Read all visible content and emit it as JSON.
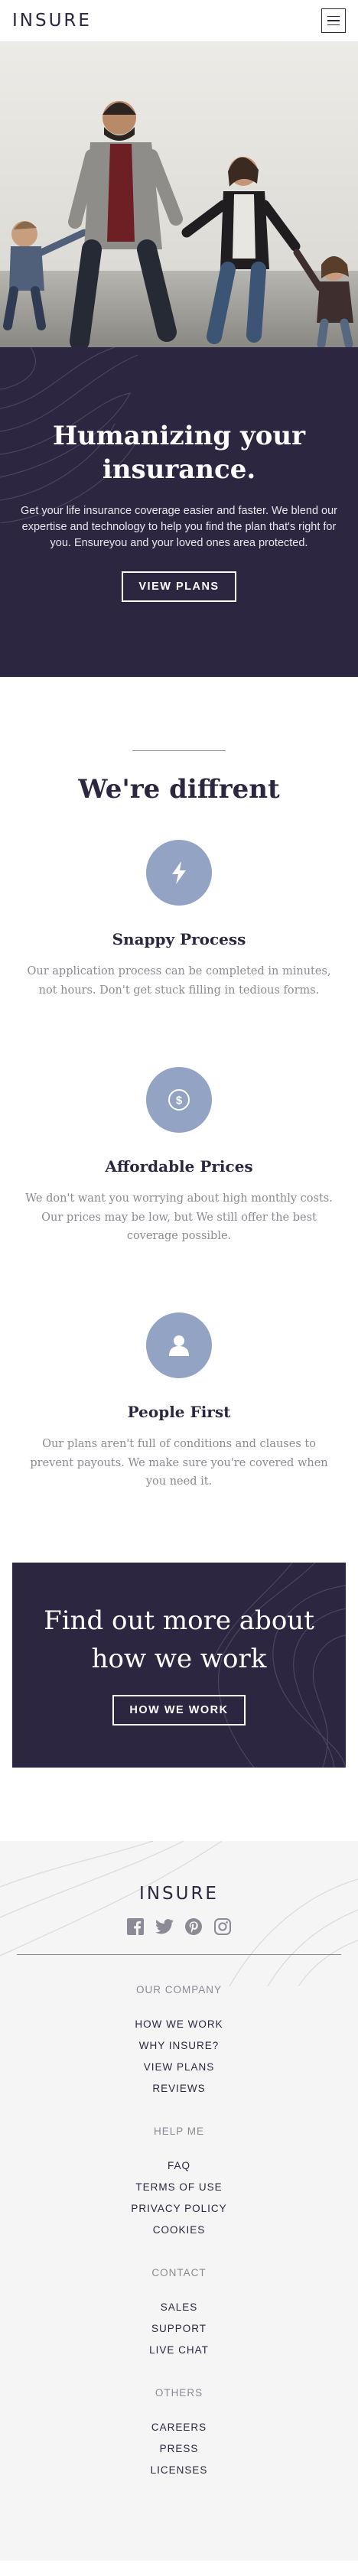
{
  "brand": {
    "logo": "INSURE"
  },
  "header": {
    "menu_icon": "hamburger-icon"
  },
  "hero_image": {
    "icon": "family-photo"
  },
  "hero": {
    "title": "Humanizing your insurance.",
    "description": "Get your life insurance coverage easier and faster. We blend our expertise and technology to help you find the plan that's right for you. Ensureyou and your loved ones area protected.",
    "button": "VIEW PLANS"
  },
  "features": {
    "heading": "We're diffrent",
    "items": [
      {
        "icon": "lightning-icon",
        "title": "Snappy Process",
        "text": "Our application process can be completed in minutes, not hours. Don't get stuck filling in tedious forms."
      },
      {
        "icon": "dollar-icon",
        "title": "Affordable Prices",
        "text": "We don't want you worrying about high monthly costs. Our prices may be low, but We still offer the best coverage possible."
      },
      {
        "icon": "person-icon",
        "title": "People First",
        "text": "Our plans aren't full of conditions and clauses to prevent payouts. We make sure you're covered when you need it."
      }
    ]
  },
  "cta": {
    "title": "Find out more about how we work",
    "button": "HOW WE WORK"
  },
  "footer": {
    "logo": "INSURE",
    "socials": [
      "facebook-icon",
      "twitter-icon",
      "pinterest-icon",
      "instagram-icon"
    ],
    "groups": [
      {
        "title": "OUR COMPANY",
        "links": [
          "HOW WE WORK",
          "WHY INSURE?",
          "VIEW PLANS",
          "REVIEWS"
        ]
      },
      {
        "title": "HELP ME",
        "links": [
          "FAQ",
          "TERMS OF USE",
          "PRIVACY POLICY",
          "COOKIES"
        ]
      },
      {
        "title": "CONTACT",
        "links": [
          "SALES",
          "SUPPORT",
          "LIVE CHAT"
        ]
      },
      {
        "title": "OTHERS",
        "links": [
          "CAREERS",
          "PRESS",
          "LICENSES"
        ]
      }
    ]
  },
  "colors": {
    "primary": "#2c2640",
    "icon_bg": "#92a3c4",
    "muted": "#8c8a94",
    "footer_bg": "#f5f5f5"
  }
}
